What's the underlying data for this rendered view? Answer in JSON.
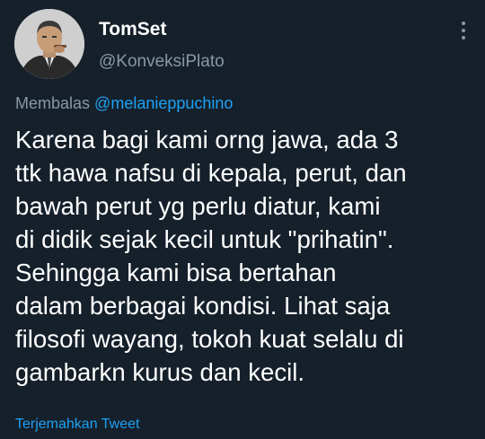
{
  "author": {
    "display_name": "TomSet",
    "handle": "@KonveksiPlato",
    "avatar_icon": "profile-photo"
  },
  "menu_icon": "more-vertical-icon",
  "reply": {
    "prefix": "Membalas",
    "mention": "@melanieppuchino"
  },
  "tweet_lines": [
    "Karena bagi kami orng jawa, ada 3",
    "ttk hawa nafsu di kepala, perut, dan",
    "bawah perut yg perlu diatur, kami",
    "di didik sejak kecil untuk \"prihatin\".",
    "Sehingga kami bisa bertahan",
    "dalam berbagai kondisi. Lihat saja",
    "filosofi wayang, tokoh kuat selalu di",
    "gambarkn kurus dan kecil."
  ],
  "translate_label": "Terjemahkan Tweet",
  "colors": {
    "background": "#15202b",
    "text_primary": "#ffffff",
    "text_secondary": "#8899a6",
    "accent": "#1da1f2"
  }
}
